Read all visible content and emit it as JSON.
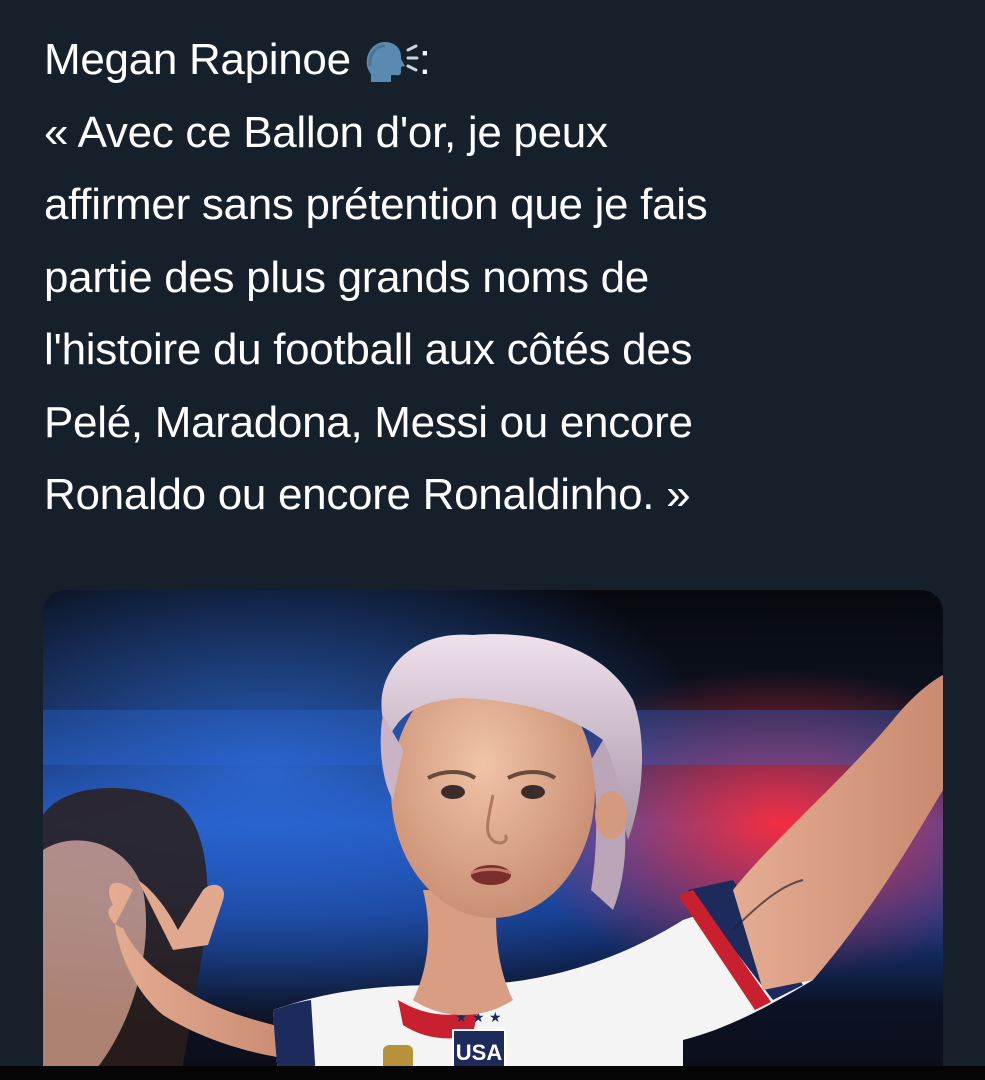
{
  "tweet": {
    "author_line": "Megan Rapinoe",
    "speaking_icon": "speaking-head-icon",
    "colon": ":",
    "lines": [
      "« Avec ce Ballon d'or, je peux",
      "affirmer sans prétention que je fais",
      "partie des plus grands noms de",
      "l'histoire du football aux côtés des",
      "Pelé, Maradona, Messi ou encore",
      "Ronaldo ou encore Ronaldinho. »"
    ]
  },
  "media": {
    "jersey_text": "USA",
    "colors": {
      "background": "#15202b",
      "text": "#ffffff",
      "jersey_white": "#f4f4f4",
      "jersey_navy": "#1c2a5c",
      "jersey_red": "#c8202e",
      "hair": "#d8c6d6",
      "skin": "#e6b59b"
    }
  }
}
